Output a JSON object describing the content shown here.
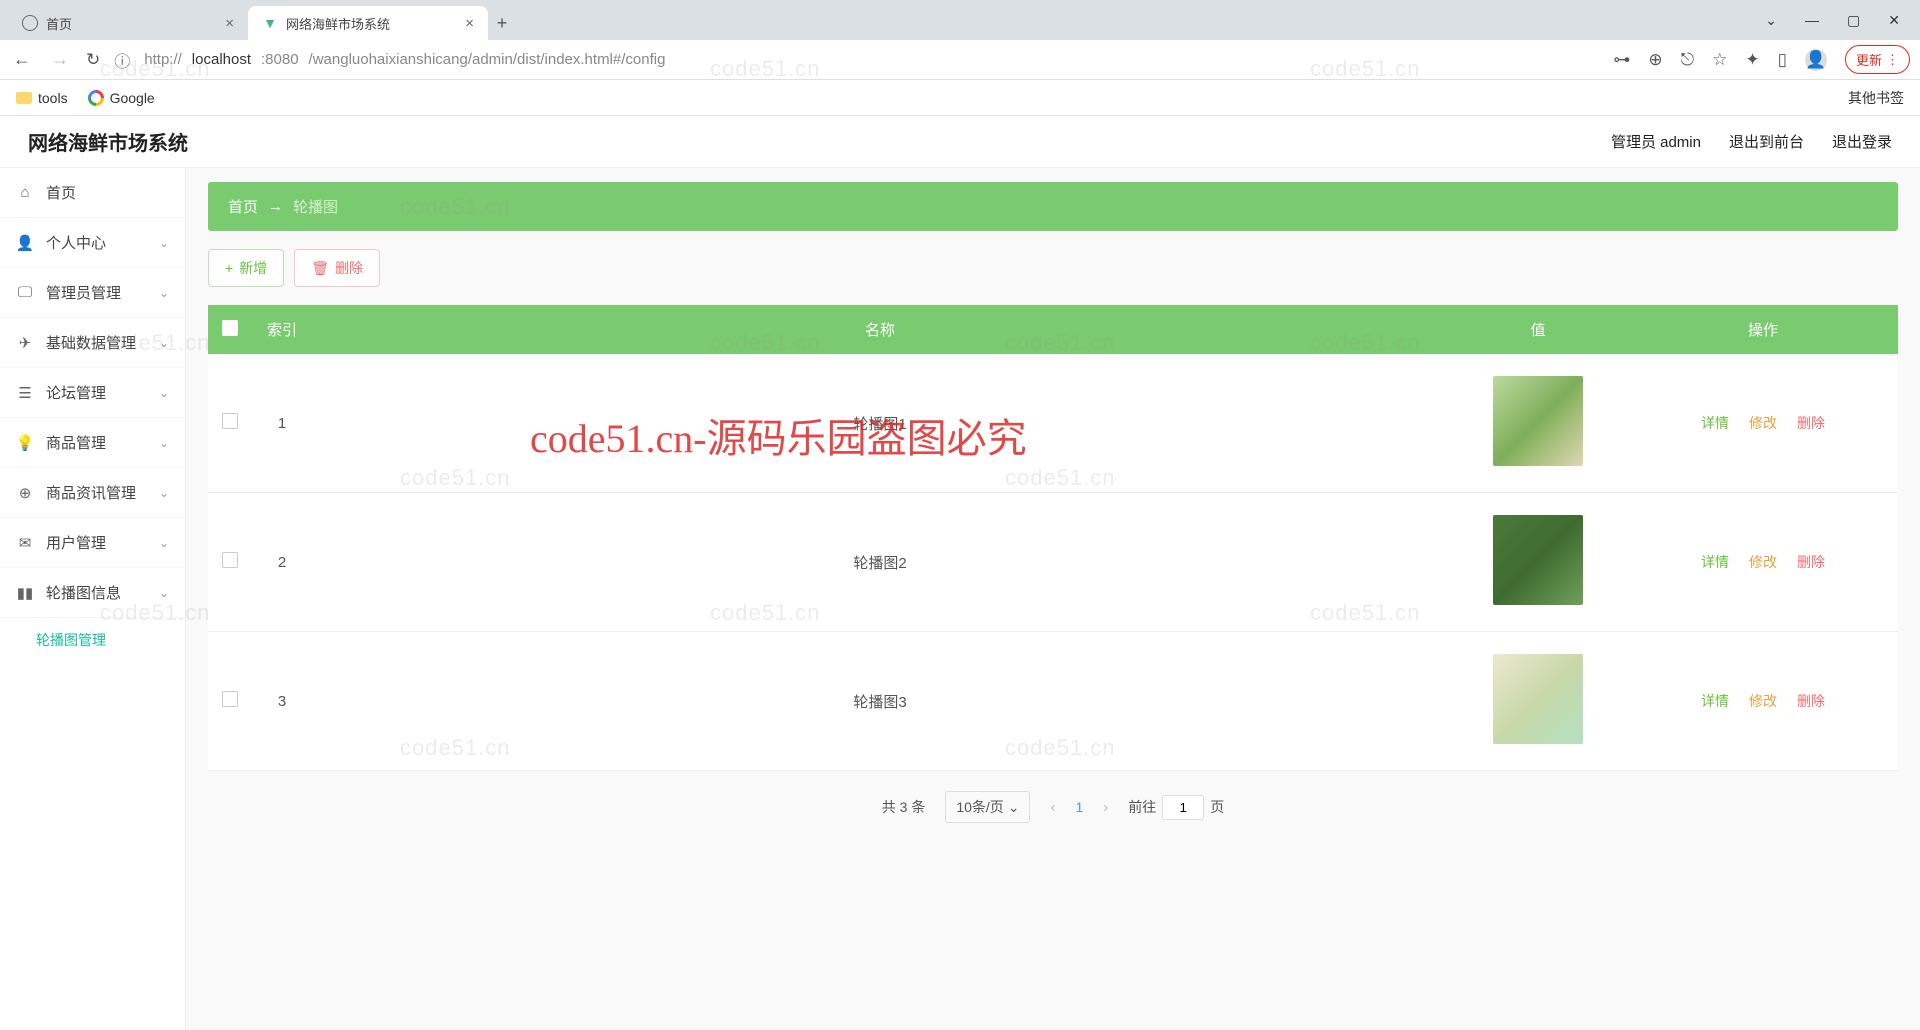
{
  "browser": {
    "tabs": [
      {
        "label": "首页",
        "active": false
      },
      {
        "label": "网络海鲜市场系统",
        "active": true
      }
    ],
    "url_full": "http://localhost:8080/wangluohaixianshicang/admin/dist/index.html#/config",
    "url_prefix": "http://",
    "url_host": "localhost",
    "url_port": ":8080",
    "url_path": "/wangluohaixianshicang/admin/dist/index.html#/config",
    "update_label": "更新",
    "bookmarks": [
      {
        "label": "tools",
        "icon": "folder"
      },
      {
        "label": "Google",
        "icon": "google"
      }
    ],
    "other_bookmarks": "其他书签"
  },
  "header": {
    "brand": "网络海鲜市场系统",
    "user": "管理员 admin",
    "exit_front": "退出到前台",
    "logout": "退出登录"
  },
  "sidebar": [
    {
      "icon": "home-icon",
      "label": "首页",
      "expandable": false
    },
    {
      "icon": "person-icon",
      "label": "个人中心",
      "expandable": true
    },
    {
      "icon": "monitor-icon",
      "label": "管理员管理",
      "expandable": true
    },
    {
      "icon": "plane-icon",
      "label": "基础数据管理",
      "expandable": true
    },
    {
      "icon": "list-icon",
      "label": "论坛管理",
      "expandable": true
    },
    {
      "icon": "bulb-icon",
      "label": "商品管理",
      "expandable": true
    },
    {
      "icon": "globe-icon",
      "label": "商品资讯管理",
      "expandable": true
    },
    {
      "icon": "mail-icon",
      "label": "用户管理",
      "expandable": true
    },
    {
      "icon": "chart-icon",
      "label": "轮播图信息",
      "expandable": true,
      "children": [
        {
          "label": "轮播图管理",
          "active": true
        }
      ]
    }
  ],
  "breadcrumb": {
    "home": "首页",
    "current": "轮播图"
  },
  "actions": {
    "add": "新增",
    "delete": "删除"
  },
  "table": {
    "headers": {
      "idx": "索引",
      "name": "名称",
      "value": "值",
      "ops": "操作"
    },
    "rows": [
      {
        "idx": "1",
        "name": "轮播图1"
      },
      {
        "idx": "2",
        "name": "轮播图2"
      },
      {
        "idx": "3",
        "name": "轮播图3"
      }
    ],
    "ops": {
      "detail": "详情",
      "edit": "修改",
      "delete": "删除"
    }
  },
  "pagination": {
    "total": "共 3 条",
    "per_page": "10条/页",
    "current": "1",
    "goto_prefix": "前往",
    "goto_suffix": "页",
    "goto_value": "1"
  },
  "watermark": "code51.cn",
  "watermark_big": "code51.cn-源码乐园盗图必究"
}
